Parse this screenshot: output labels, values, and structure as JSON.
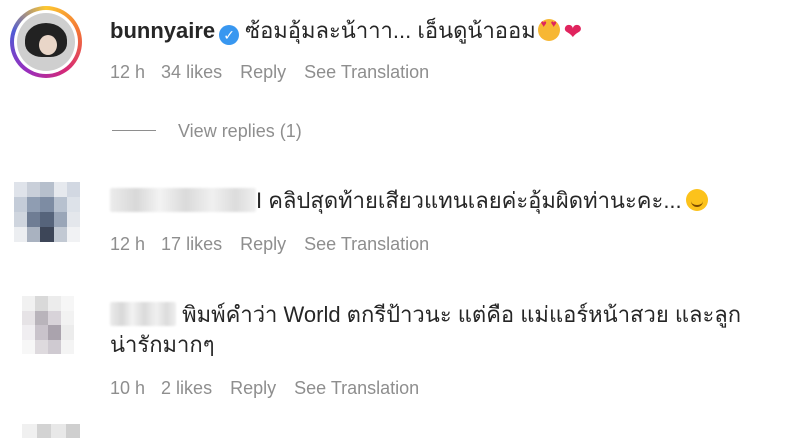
{
  "comments": [
    {
      "username": "bunnyaire",
      "text": "ซ้อมอุ้มละน้าาา... เอ็นดูน้าออม",
      "time": "12 h",
      "likes": "34 likes",
      "reply_label": "Reply",
      "translate_label": "See Translation",
      "view_replies": "View replies (1)"
    },
    {
      "username": "",
      "text": "I คลิปสุดท้ายเสียวแทนเลยค่ะอุ้มผิดท่านะคะ...",
      "time": "12 h",
      "likes": "17 likes",
      "reply_label": "Reply",
      "translate_label": "See Translation"
    },
    {
      "username": "",
      "text_line1": "พิมพ์คำว่า World ตกรีป้าวนะ แต่คือ แม่แอร์หน้าสวย และลูก",
      "text_line2": "น่ารักมากๆ",
      "time": "10 h",
      "likes": "2 likes",
      "reply_label": "Reply",
      "translate_label": "See Translation"
    }
  ],
  "colors": {
    "text": "#262626",
    "muted": "#8e8e8e",
    "verified": "#3897f0",
    "heart": "#e0245e"
  },
  "icons": [
    "verified-badge-icon",
    "heart-eyes-emoji-icon",
    "red-heart-emoji-icon",
    "smile-emoji-icon"
  ]
}
